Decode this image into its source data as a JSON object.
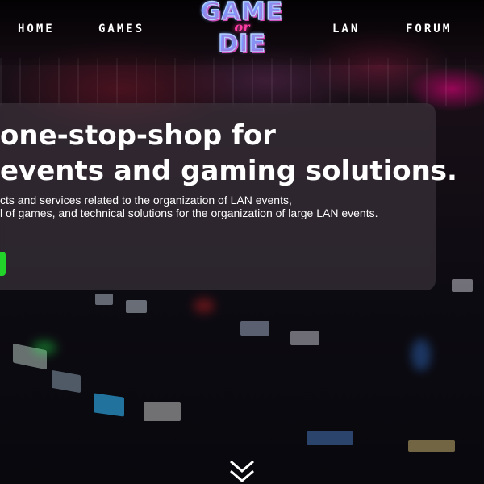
{
  "nav": {
    "items": [
      {
        "label": "HOME"
      },
      {
        "label": "GAMES"
      },
      {
        "label": "LAN"
      },
      {
        "label": "FORUM"
      }
    ],
    "logo": {
      "line1": "GAME",
      "line2": "or",
      "line3": "DIE"
    }
  },
  "hero": {
    "heading_line1": "one-stop-shop for",
    "heading_line2": "events and gaming solutions.",
    "body_line1": "cts and services related to the organization of LAN events,",
    "body_line2": "l of games, and technical solutions for the organization of large LAN events."
  },
  "colors": {
    "cta": "#22d32a",
    "logo_accent": "#ff3ea5"
  },
  "icons": {
    "scroll": "double-chevron-down-icon"
  }
}
